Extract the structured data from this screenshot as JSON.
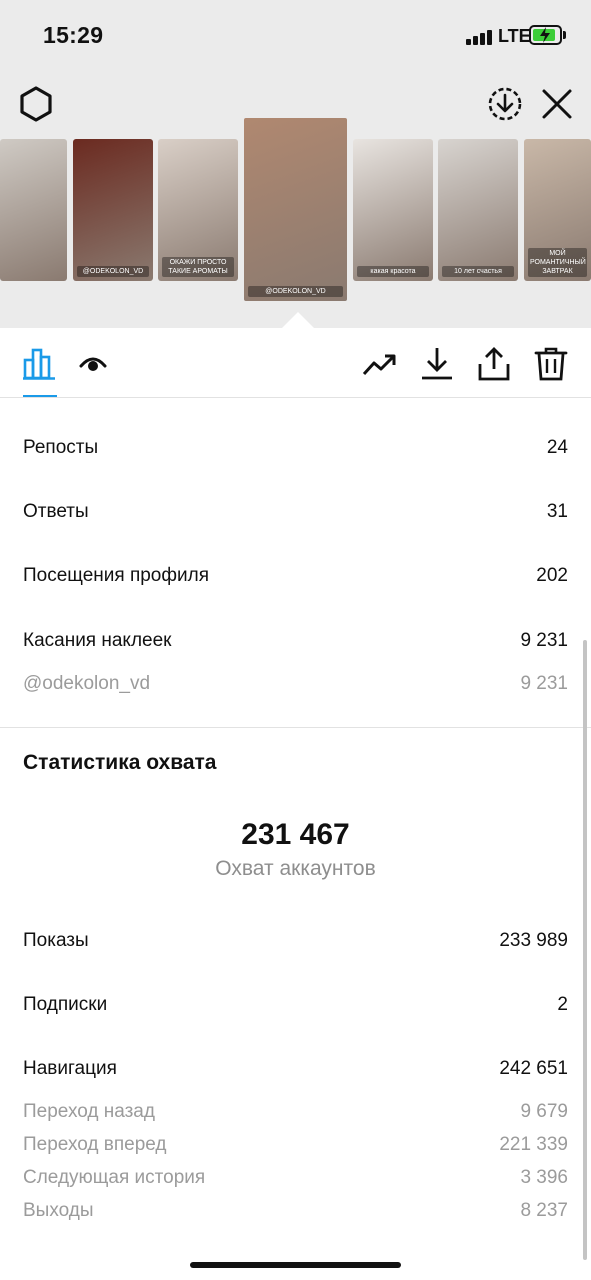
{
  "status_bar": {
    "time": "15:29",
    "network": "LTE"
  },
  "colors": {
    "accent": "#1a9ae8",
    "muted": "#9b9b9b",
    "battery": "#3ccd38"
  },
  "header": {
    "icons": [
      "settings-icon",
      "download-circle-icon",
      "close-icon"
    ]
  },
  "stories": [
    {
      "label": "",
      "bg": "#cfcac4"
    },
    {
      "label": "@ODEKOLON_VD",
      "bg": "#6b2a20"
    },
    {
      "label": "ОКАЖИ ПРОСТО ТАКИЕ АРОМАТЫ",
      "bg": "#d9cfc7"
    },
    {
      "label": "@ODEKOLON_VD",
      "bg": "#b08870"
    },
    {
      "label": "какая красота",
      "bg": "#e8e4e0"
    },
    {
      "label": "10 лет счастья",
      "bg": "#d8d4d0"
    },
    {
      "label": "МОЙ РОМАНТИЧНЫЙ ЗАВТРАК",
      "bg": "#c9b8a8"
    }
  ],
  "tabs": {
    "icons": [
      "bar-chart-icon",
      "eye-icon",
      "trend-icon",
      "download-icon",
      "share-icon",
      "trash-icon"
    ]
  },
  "stats": [
    {
      "label": "Репосты",
      "value": "24"
    },
    {
      "label": "Ответы",
      "value": "31"
    },
    {
      "label": "Посещения профиля",
      "value": "202"
    },
    {
      "label": "Касания наклеек",
      "value": "9 231"
    },
    {
      "label": "@odekolon_vd",
      "value": "9 231"
    }
  ],
  "reach": {
    "title": "Статистика охвата",
    "value": "231 467",
    "label": "Охват аккаунтов",
    "rows": [
      {
        "label": "Показы",
        "value": "233 989"
      },
      {
        "label": "Подписки",
        "value": "2"
      },
      {
        "label": "Навигация",
        "value": "242 651"
      },
      {
        "label": "Переход назад",
        "value": "9 679"
      },
      {
        "label": "Переход вперед",
        "value": "221 339"
      },
      {
        "label": "Следующая история",
        "value": "3 396"
      },
      {
        "label": "Выходы",
        "value": "8 237"
      }
    ]
  }
}
